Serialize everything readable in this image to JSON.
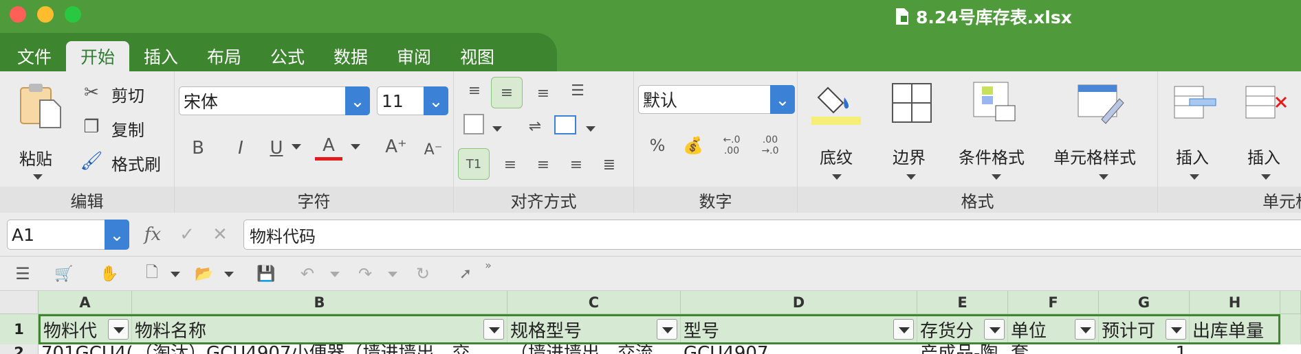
{
  "window": {
    "title": "8.24号库存表.xlsx"
  },
  "tabs": [
    "文件",
    "开始",
    "插入",
    "布局",
    "公式",
    "数据",
    "审阅",
    "视图"
  ],
  "active_tab": "开始",
  "ribbon": {
    "clipboard": {
      "paste": "粘贴",
      "cut": "剪切",
      "copy": "复制",
      "format_painter": "格式刷",
      "group": "编辑"
    },
    "font": {
      "name": "宋体",
      "size": "11",
      "group": "字符",
      "bold": "B",
      "italic": "I",
      "underline": "U",
      "color": "A"
    },
    "alignment": {
      "group": "对齐方式"
    },
    "number": {
      "format": "默认",
      "percent": "%",
      "inc": "+.0\n.00",
      "dec": ".00\n→.0",
      "group": "数字"
    },
    "styles": {
      "fill": "底纹",
      "border": "边界",
      "cond": "条件格式",
      "cellstyle": "单元格样式",
      "group": "格式"
    },
    "cells": {
      "insert1": "插入",
      "insert2": "插入",
      "group": "单元格"
    }
  },
  "formula_bar": {
    "name_box": "A1",
    "fx": "fx",
    "content": "物料代码"
  },
  "columns": [
    "A",
    "B",
    "C",
    "D",
    "E",
    "F",
    "G",
    "H"
  ],
  "row_numbers": [
    "1",
    "2"
  ],
  "header_row": [
    "物料代",
    "物料名称",
    "规格型号",
    "型号",
    "存货分",
    "单位",
    "预计可",
    "出库单量"
  ],
  "row2": [
    "701GCU4(",
    "（淘汰）GCU4907小便器（墙进墙出，交",
    "（墙进墙出，交流",
    "GCU4907",
    "产成品-陶",
    "套",
    "1",
    ""
  ],
  "colors": {
    "title_green": "#4f9a3b",
    "dark_green": "#3e8530",
    "dropdown_blue": "#3b82d6",
    "header_fill": "#d6e9d2"
  }
}
